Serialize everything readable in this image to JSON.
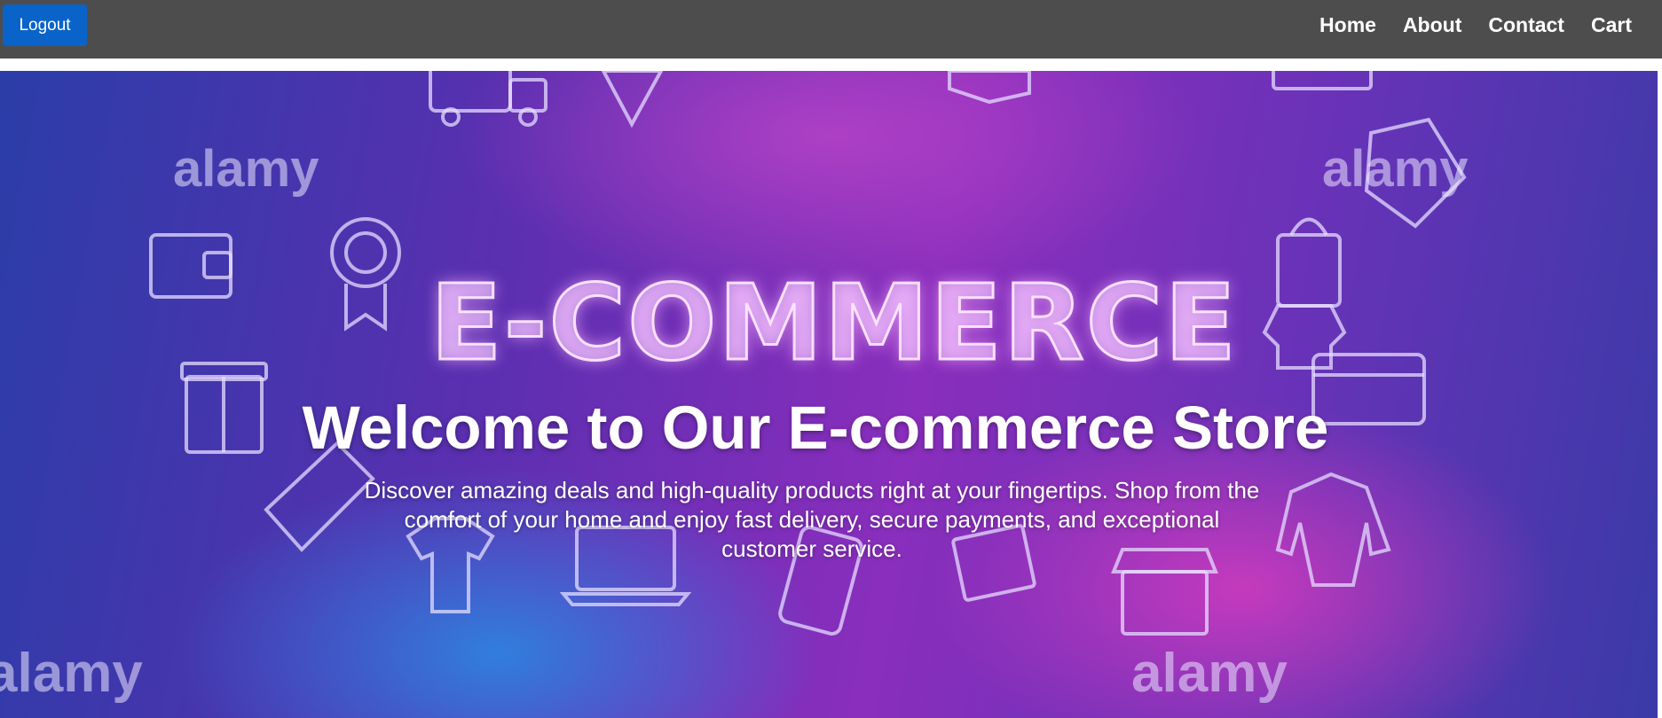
{
  "navbar": {
    "logout_label": "Logout",
    "links": [
      {
        "label": "Home"
      },
      {
        "label": "About"
      },
      {
        "label": "Contact"
      },
      {
        "label": "Cart"
      }
    ]
  },
  "hero": {
    "banner_text": "E-COMMERCE",
    "watermark": "alamy",
    "title": "Welcome to Our E-commerce Store",
    "description": "Discover amazing deals and high-quality products right at your fingertips. Shop from the comfort of your home and enjoy fast delivery, secure payments, and exceptional customer service."
  },
  "colors": {
    "navbar_bg": "#4d4d4d",
    "logout_bg": "#0a63c9",
    "hero_purple": "#8a2ebd",
    "hero_blue": "#2b3da8"
  }
}
